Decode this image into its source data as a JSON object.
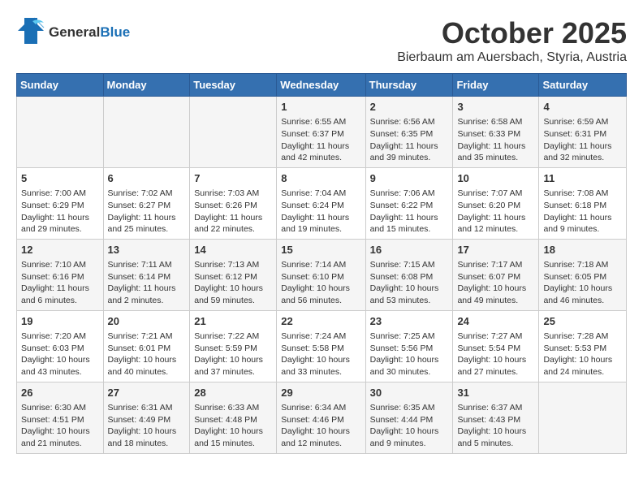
{
  "logo": {
    "general": "General",
    "blue": "Blue"
  },
  "title": "October 2025",
  "location": "Bierbaum am Auersbach, Styria, Austria",
  "headers": [
    "Sunday",
    "Monday",
    "Tuesday",
    "Wednesday",
    "Thursday",
    "Friday",
    "Saturday"
  ],
  "weeks": [
    [
      {
        "day": "",
        "info": ""
      },
      {
        "day": "",
        "info": ""
      },
      {
        "day": "",
        "info": ""
      },
      {
        "day": "1",
        "info": "Sunrise: 6:55 AM\nSunset: 6:37 PM\nDaylight: 11 hours\nand 42 minutes."
      },
      {
        "day": "2",
        "info": "Sunrise: 6:56 AM\nSunset: 6:35 PM\nDaylight: 11 hours\nand 39 minutes."
      },
      {
        "day": "3",
        "info": "Sunrise: 6:58 AM\nSunset: 6:33 PM\nDaylight: 11 hours\nand 35 minutes."
      },
      {
        "day": "4",
        "info": "Sunrise: 6:59 AM\nSunset: 6:31 PM\nDaylight: 11 hours\nand 32 minutes."
      }
    ],
    [
      {
        "day": "5",
        "info": "Sunrise: 7:00 AM\nSunset: 6:29 PM\nDaylight: 11 hours\nand 29 minutes."
      },
      {
        "day": "6",
        "info": "Sunrise: 7:02 AM\nSunset: 6:27 PM\nDaylight: 11 hours\nand 25 minutes."
      },
      {
        "day": "7",
        "info": "Sunrise: 7:03 AM\nSunset: 6:26 PM\nDaylight: 11 hours\nand 22 minutes."
      },
      {
        "day": "8",
        "info": "Sunrise: 7:04 AM\nSunset: 6:24 PM\nDaylight: 11 hours\nand 19 minutes."
      },
      {
        "day": "9",
        "info": "Sunrise: 7:06 AM\nSunset: 6:22 PM\nDaylight: 11 hours\nand 15 minutes."
      },
      {
        "day": "10",
        "info": "Sunrise: 7:07 AM\nSunset: 6:20 PM\nDaylight: 11 hours\nand 12 minutes."
      },
      {
        "day": "11",
        "info": "Sunrise: 7:08 AM\nSunset: 6:18 PM\nDaylight: 11 hours\nand 9 minutes."
      }
    ],
    [
      {
        "day": "12",
        "info": "Sunrise: 7:10 AM\nSunset: 6:16 PM\nDaylight: 11 hours\nand 6 minutes."
      },
      {
        "day": "13",
        "info": "Sunrise: 7:11 AM\nSunset: 6:14 PM\nDaylight: 11 hours\nand 2 minutes."
      },
      {
        "day": "14",
        "info": "Sunrise: 7:13 AM\nSunset: 6:12 PM\nDaylight: 10 hours\nand 59 minutes."
      },
      {
        "day": "15",
        "info": "Sunrise: 7:14 AM\nSunset: 6:10 PM\nDaylight: 10 hours\nand 56 minutes."
      },
      {
        "day": "16",
        "info": "Sunrise: 7:15 AM\nSunset: 6:08 PM\nDaylight: 10 hours\nand 53 minutes."
      },
      {
        "day": "17",
        "info": "Sunrise: 7:17 AM\nSunset: 6:07 PM\nDaylight: 10 hours\nand 49 minutes."
      },
      {
        "day": "18",
        "info": "Sunrise: 7:18 AM\nSunset: 6:05 PM\nDaylight: 10 hours\nand 46 minutes."
      }
    ],
    [
      {
        "day": "19",
        "info": "Sunrise: 7:20 AM\nSunset: 6:03 PM\nDaylight: 10 hours\nand 43 minutes."
      },
      {
        "day": "20",
        "info": "Sunrise: 7:21 AM\nSunset: 6:01 PM\nDaylight: 10 hours\nand 40 minutes."
      },
      {
        "day": "21",
        "info": "Sunrise: 7:22 AM\nSunset: 5:59 PM\nDaylight: 10 hours\nand 37 minutes."
      },
      {
        "day": "22",
        "info": "Sunrise: 7:24 AM\nSunset: 5:58 PM\nDaylight: 10 hours\nand 33 minutes."
      },
      {
        "day": "23",
        "info": "Sunrise: 7:25 AM\nSunset: 5:56 PM\nDaylight: 10 hours\nand 30 minutes."
      },
      {
        "day": "24",
        "info": "Sunrise: 7:27 AM\nSunset: 5:54 PM\nDaylight: 10 hours\nand 27 minutes."
      },
      {
        "day": "25",
        "info": "Sunrise: 7:28 AM\nSunset: 5:53 PM\nDaylight: 10 hours\nand 24 minutes."
      }
    ],
    [
      {
        "day": "26",
        "info": "Sunrise: 6:30 AM\nSunset: 4:51 PM\nDaylight: 10 hours\nand 21 minutes."
      },
      {
        "day": "27",
        "info": "Sunrise: 6:31 AM\nSunset: 4:49 PM\nDaylight: 10 hours\nand 18 minutes."
      },
      {
        "day": "28",
        "info": "Sunrise: 6:33 AM\nSunset: 4:48 PM\nDaylight: 10 hours\nand 15 minutes."
      },
      {
        "day": "29",
        "info": "Sunrise: 6:34 AM\nSunset: 4:46 PM\nDaylight: 10 hours\nand 12 minutes."
      },
      {
        "day": "30",
        "info": "Sunrise: 6:35 AM\nSunset: 4:44 PM\nDaylight: 10 hours\nand 9 minutes."
      },
      {
        "day": "31",
        "info": "Sunrise: 6:37 AM\nSunset: 4:43 PM\nDaylight: 10 hours\nand 5 minutes."
      },
      {
        "day": "",
        "info": ""
      }
    ]
  ]
}
